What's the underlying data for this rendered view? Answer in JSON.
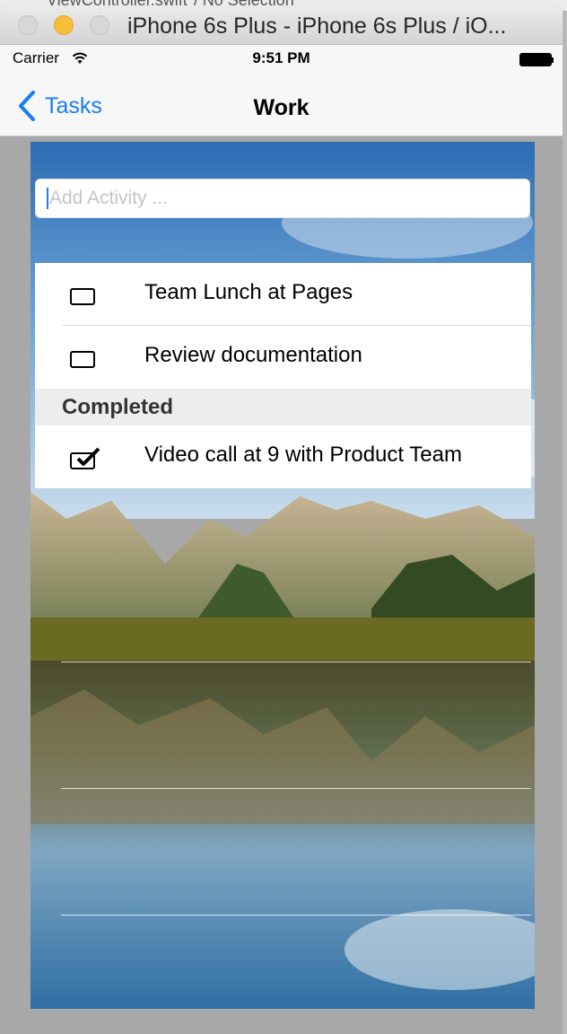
{
  "editor": {
    "behind_title": "ViewController.swift ⟩ No Selection"
  },
  "window": {
    "title": "iPhone 6s Plus - iPhone 6s Plus / iO..."
  },
  "statusbar": {
    "carrier": "Carrier",
    "time": "9:51 PM"
  },
  "navbar": {
    "back_label": "Tasks",
    "title": "Work"
  },
  "add_activity": {
    "placeholder": "Add Activity ...",
    "value": ""
  },
  "tasks": [
    {
      "label": "Team Lunch at Pages",
      "checked": false
    },
    {
      "label": "Review documentation",
      "checked": false
    }
  ],
  "completed_section": {
    "header": "Completed"
  },
  "completed": [
    {
      "label": "Video call at 9 with Product Team",
      "checked": true
    }
  ],
  "colors": {
    "accent": "#1a7cfa",
    "minimize": "#f7be3c",
    "section_bg": "#ededed"
  },
  "icons": [
    "wifi-icon",
    "battery-icon",
    "chevron-left-icon",
    "checkbox-icon",
    "checkmark-icon"
  ]
}
